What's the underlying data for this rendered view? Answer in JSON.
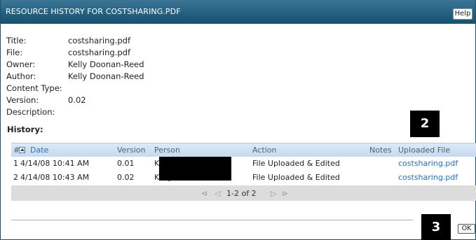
{
  "window": {
    "title": "RESOURCE HISTORY FOR COSTSHARING.PDF",
    "help_label": "Help"
  },
  "metadata": [
    {
      "key": "Title:",
      "value": "costsharing.pdf"
    },
    {
      "key": "File:",
      "value": "costsharing.pdf"
    },
    {
      "key": "Owner:",
      "value": "Kelly Doonan-Reed"
    },
    {
      "key": "Author:",
      "value": "Kelly Doonan-Reed"
    },
    {
      "key": "Content Type:",
      "value": ""
    },
    {
      "key": "Version:",
      "value": "0.02"
    },
    {
      "key": "Description:",
      "value": ""
    }
  ],
  "history": {
    "label": "History:",
    "columns": {
      "num": "#",
      "date": "Date",
      "version": "Version",
      "person": "Person",
      "action": "Action",
      "notes": "Notes",
      "uploaded_file": "Uploaded File"
    },
    "rows": [
      {
        "num": "1",
        "date": "4/14/08 10:41 AM",
        "version": "0.01",
        "person": "K",
        "action": "File Uploaded & Edited",
        "notes": "",
        "file": "costsharing.pdf"
      },
      {
        "num": "2",
        "date": "4/14/08 10:43 AM",
        "version": "0.02",
        "person": "Kelly Doonan-Reed",
        "action": "File Uploaded & Edited",
        "notes": "",
        "file": "costsharing.pdf"
      }
    ],
    "pager": {
      "first_icon": "⊲",
      "prev_icon": "◁",
      "range": "1-2 of 2",
      "next_icon": "▷",
      "last_icon": "⊳"
    }
  },
  "annotations": {
    "badge_2": "2",
    "badge_3": "3"
  },
  "footer": {
    "ok_label": "OK"
  }
}
